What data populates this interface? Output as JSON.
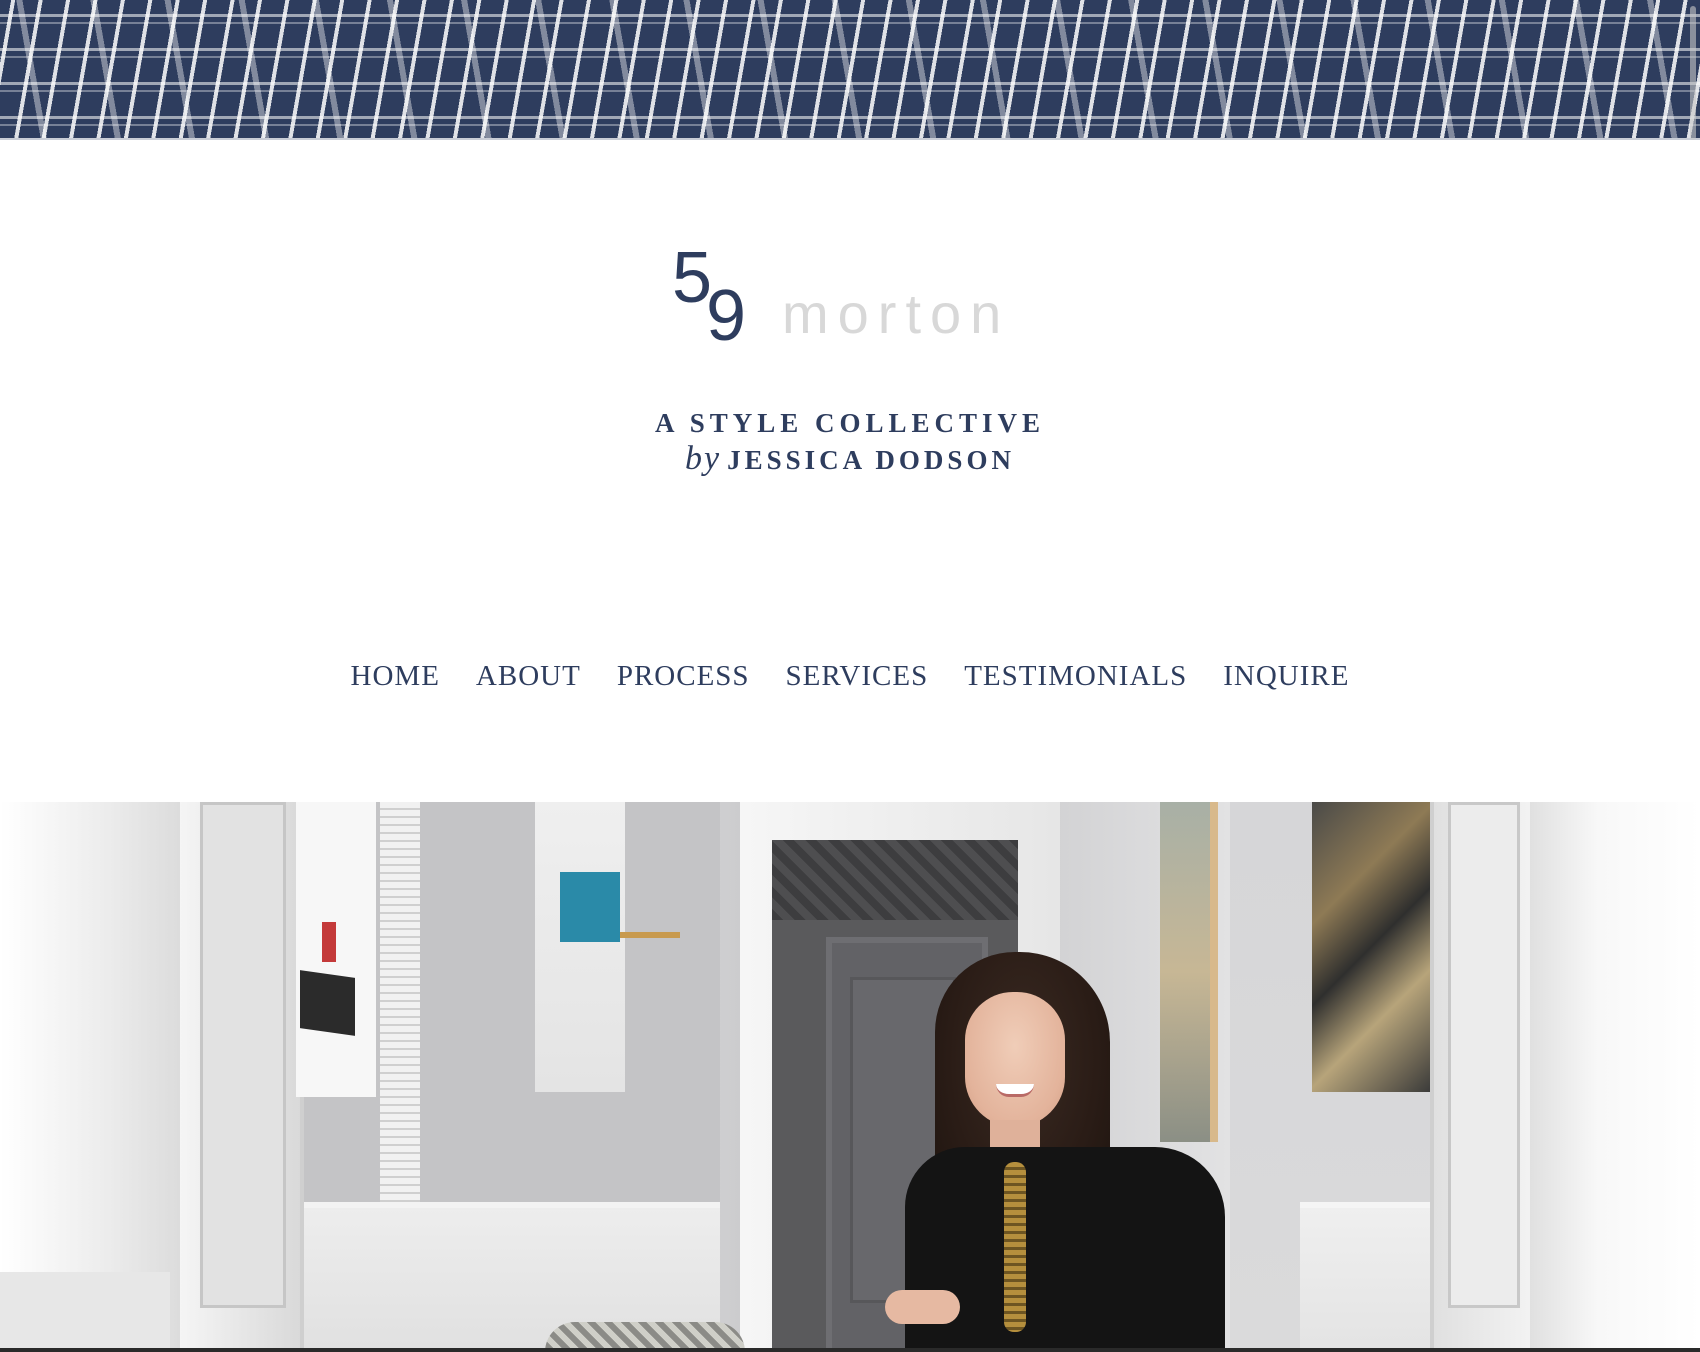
{
  "brand": {
    "logo_number_first": "5",
    "logo_number_second": "9",
    "logo_word": "morton",
    "tagline_line1": "A STYLE COLLECTIVE",
    "tagline_by": "by",
    "tagline_name": "JESSICA DODSON",
    "colors": {
      "navy": "#2e3d5e",
      "logo_word_gray": "#d8d8d8"
    }
  },
  "nav": {
    "items": [
      {
        "label": "HOME"
      },
      {
        "label": "ABOUT"
      },
      {
        "label": "PROCESS"
      },
      {
        "label": "SERVICES"
      },
      {
        "label": "TESTIMONIALS"
      },
      {
        "label": "INQUIRE"
      }
    ]
  },
  "hero": {
    "image_subject": "portrait-photo"
  }
}
